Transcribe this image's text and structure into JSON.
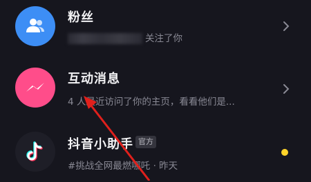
{
  "messages": [
    {
      "title": "粉丝",
      "subtitle_suffix": "关注了你",
      "avatar_icon": "people-icon",
      "avatar_color": "#3d8ef5",
      "has_chevron": true
    },
    {
      "title": "互动消息",
      "subtitle": "4 人最近访问了你的主页，看看他们是...",
      "avatar_icon": "messenger-bolt-icon",
      "avatar_color": "#ff4d8a",
      "has_chevron": true
    },
    {
      "title": "抖音小助手",
      "badge": "官方",
      "subtitle": "#挑战全网最燃哪吒 · 昨天",
      "avatar_icon": "tiktok-logo-icon",
      "avatar_color": "#1e1e27",
      "unread_dot_color": "#ffd42a"
    }
  ],
  "colors": {
    "background": "#16161e",
    "title_text": "#f2f2f4",
    "subtitle_text": "#8a8a95",
    "annotation_arrow": "#e0201c"
  }
}
